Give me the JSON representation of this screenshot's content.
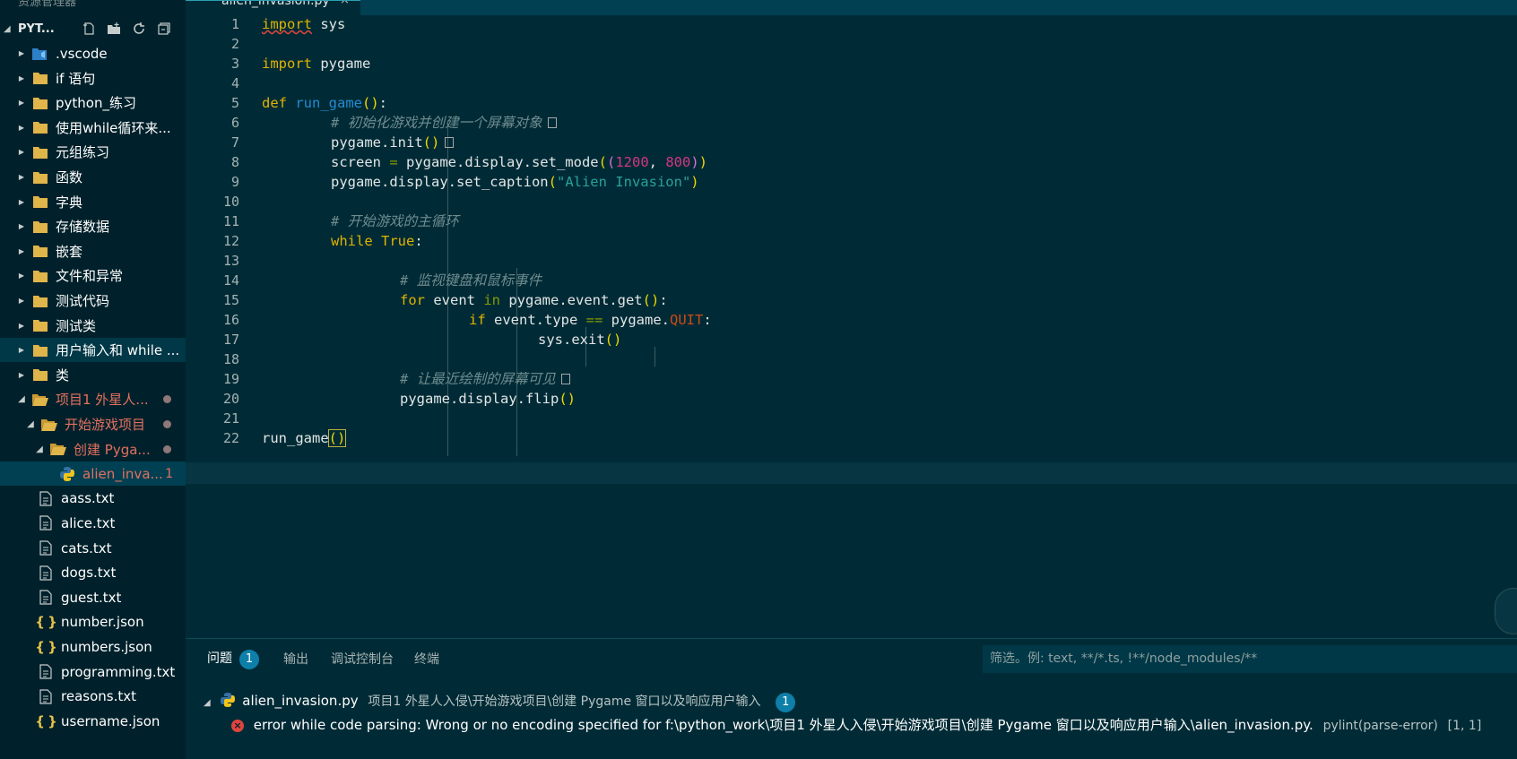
{
  "explorer": {
    "top_label": "资源管理器",
    "section_title": "PYT...",
    "items": [
      {
        "label": ".vscode",
        "icon": "vscode-folder-icon",
        "kind": "folder"
      },
      {
        "label": "if 语句",
        "icon": "folder-icon",
        "kind": "folder"
      },
      {
        "label": "python_练习",
        "icon": "folder-icon",
        "kind": "folder"
      },
      {
        "label": "使用while循环来...",
        "icon": "folder-icon",
        "kind": "folder"
      },
      {
        "label": "元组练习",
        "icon": "folder-icon",
        "kind": "folder"
      },
      {
        "label": "函数",
        "icon": "folder-icon",
        "kind": "folder"
      },
      {
        "label": "字典",
        "icon": "folder-icon",
        "kind": "folder"
      },
      {
        "label": "存储数据",
        "icon": "folder-icon",
        "kind": "folder"
      },
      {
        "label": "嵌套",
        "icon": "folder-icon",
        "kind": "folder"
      },
      {
        "label": "文件和异常",
        "icon": "folder-icon",
        "kind": "folder"
      },
      {
        "label": "测试代码",
        "icon": "folder-icon",
        "kind": "folder"
      },
      {
        "label": "测试类",
        "icon": "folder-icon",
        "kind": "folder"
      },
      {
        "label": "用户输入和 while ...",
        "icon": "folder-icon",
        "kind": "folder"
      },
      {
        "label": "类",
        "icon": "folder-icon",
        "kind": "folder"
      },
      {
        "label": "项目1 外星人...",
        "icon": "open-folder-icon",
        "kind": "folder-open"
      },
      {
        "label": "开始游戏项目",
        "icon": "open-folder-icon",
        "kind": "folder-open"
      },
      {
        "label": "创建 Pyga...",
        "icon": "open-folder-icon",
        "kind": "folder-open"
      },
      {
        "label": "alien_inva...",
        "icon": "python-file-icon",
        "kind": "file",
        "count": "1"
      },
      {
        "label": "aass.txt",
        "icon": "text-file-icon",
        "kind": "file"
      },
      {
        "label": "alice.txt",
        "icon": "text-file-icon",
        "kind": "file"
      },
      {
        "label": "cats.txt",
        "icon": "text-file-icon",
        "kind": "file"
      },
      {
        "label": "dogs.txt",
        "icon": "text-file-icon",
        "kind": "file"
      },
      {
        "label": "guest.txt",
        "icon": "text-file-icon",
        "kind": "file"
      },
      {
        "label": "number.json",
        "icon": "json-file-icon",
        "kind": "file"
      },
      {
        "label": "numbers.json",
        "icon": "json-file-icon",
        "kind": "file"
      },
      {
        "label": "programming.txt",
        "icon": "text-file-icon",
        "kind": "file"
      },
      {
        "label": "reasons.txt",
        "icon": "text-file-icon",
        "kind": "file"
      },
      {
        "label": "username.json",
        "icon": "json-file-icon",
        "kind": "file"
      }
    ]
  },
  "tab": {
    "label": "alien_invasion.py",
    "close": "×"
  },
  "editor": {
    "line_numbers": [
      "1",
      "2",
      "3",
      "4",
      "5",
      "6",
      "7",
      "8",
      "9",
      "10",
      "11",
      "12",
      "13",
      "14",
      "15",
      "16",
      "17",
      "18",
      "19",
      "20",
      "21",
      "22"
    ],
    "code": {
      "l1_kw": "import",
      "l1_rest": " sys",
      "l3_kw": "import",
      "l3_rest": " pygame",
      "l5_kw": "def",
      "l5_fn": "run_game",
      "l5_paren": "()",
      "l5_colon": ":",
      "l6_cmt": "# 初始化游戏并创建一个屏幕对象",
      "l7_code": "pygame.init",
      "l7_paren": "()",
      "l8_a": "screen ",
      "l8_eq": "=",
      "l8_b": " pygame.display.set_mode",
      "l8_o1": "(",
      "l8_o2": "(",
      "l8_n1": "1200",
      "l8_comma": ", ",
      "l8_n2": "800",
      "l8_c2": ")",
      "l8_c1": ")",
      "l9_a": "pygame.display.set_caption",
      "l9_o": "(",
      "l9_str": "\"Alien Invasion\"",
      "l9_c": ")",
      "l11_cmt": "# 开始游戏的主循环",
      "l12_kw": "while",
      "l12_true": "True",
      "l12_colon": ":",
      "l14_cmt": "# 监视键盘和鼠标事件",
      "l15_kw": "for",
      "l15_a": " event ",
      "l15_in": "in",
      "l15_b": " pygame.event.get",
      "l15_paren": "()",
      "l15_colon": ":",
      "l16_kw": "if",
      "l16_a": " event.type ",
      "l16_eq": "==",
      "l16_b": " pygame.",
      "l16_const": "QUIT",
      "l16_colon": ":",
      "l17_a": "sys.exit",
      "l17_paren": "()",
      "l19_cmt": "# 让最近绘制的屏幕可见",
      "l20_a": "pygame.display.flip",
      "l20_paren": "()",
      "l22_a": "run_game",
      "l22_paren": "()"
    }
  },
  "panel": {
    "tabs": {
      "problems": "问题",
      "output": "输出",
      "debug_console": "调试控制台",
      "terminal": "终端"
    },
    "problems_count": "1",
    "filter_placeholder": "筛选。例: text, **/*.ts, !**/node_modules/**",
    "file_row": {
      "filename": "alien_invasion.py",
      "path": "项目1 外星人入侵\\开始游戏项目\\创建 Pygame 窗口以及响应用户输入",
      "count": "1"
    },
    "error_row": {
      "message": "error while code parsing: Wrong or no encoding specified for f:\\python_work\\项目1 外星人入侵\\开始游戏项目\\创建 Pygame 窗口以及响应用户输入\\alien_invasion.py.",
      "source": "pylint(parse-error)",
      "position": "[1, 1]"
    }
  },
  "colors": {
    "background": "#002b36",
    "sidebar": "#00212b",
    "keyword": "#e0b300",
    "function": "#268bd2",
    "string": "#2aa198",
    "number": "#d33682",
    "error": "#e0443e",
    "git_modified": "#e3705f",
    "badge": "#0e7fa8"
  }
}
